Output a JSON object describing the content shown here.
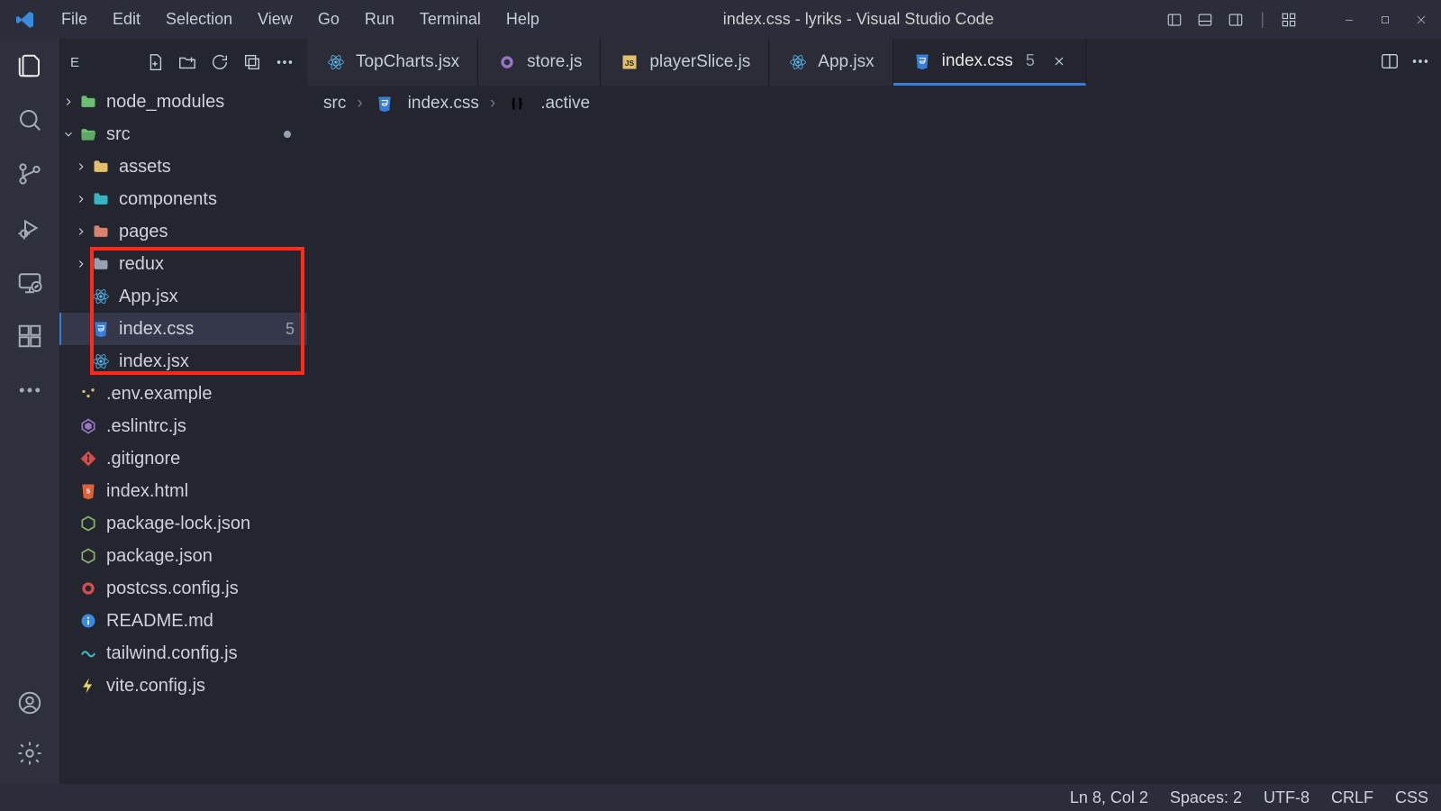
{
  "title": "index.css - lyriks - Visual Studio Code",
  "menu": {
    "file": "File",
    "edit": "Edit",
    "selection": "Selection",
    "view": "View",
    "go": "Go",
    "run": "Run",
    "terminal": "Terminal",
    "help": "Help"
  },
  "sidebar_header": {
    "label": "E"
  },
  "tree": {
    "node_modules": "node_modules",
    "src": "src",
    "assets": "assets",
    "components": "components",
    "pages": "pages",
    "redux": "redux",
    "app_jsx": "App.jsx",
    "index_css": "index.css",
    "index_css_count": "5",
    "index_jsx": "index.jsx",
    "env_example": ".env.example",
    "eslintrc": ".eslintrc.js",
    "gitignore": ".gitignore",
    "index_html": "index.html",
    "package_lock": "package-lock.json",
    "package_json": "package.json",
    "postcss": "postcss.config.js",
    "readme": "README.md",
    "tailwind": "tailwind.config.js",
    "vite": "vite.config.js"
  },
  "tabs": {
    "topcharts": "TopCharts.jsx",
    "store": "store.js",
    "playerslice": "playerSlice.js",
    "app": "App.jsx",
    "indexcss": "index.css",
    "indexcss_count": "5"
  },
  "breadcrumb": {
    "seg1": "src",
    "seg2": "index.css",
    "seg3": ".active"
  },
  "status": {
    "lncol": "Ln 8, Col 2",
    "spaces": "Spaces: 2",
    "encoding": "UTF-8",
    "eol": "CRLF",
    "lang": "CSS"
  }
}
